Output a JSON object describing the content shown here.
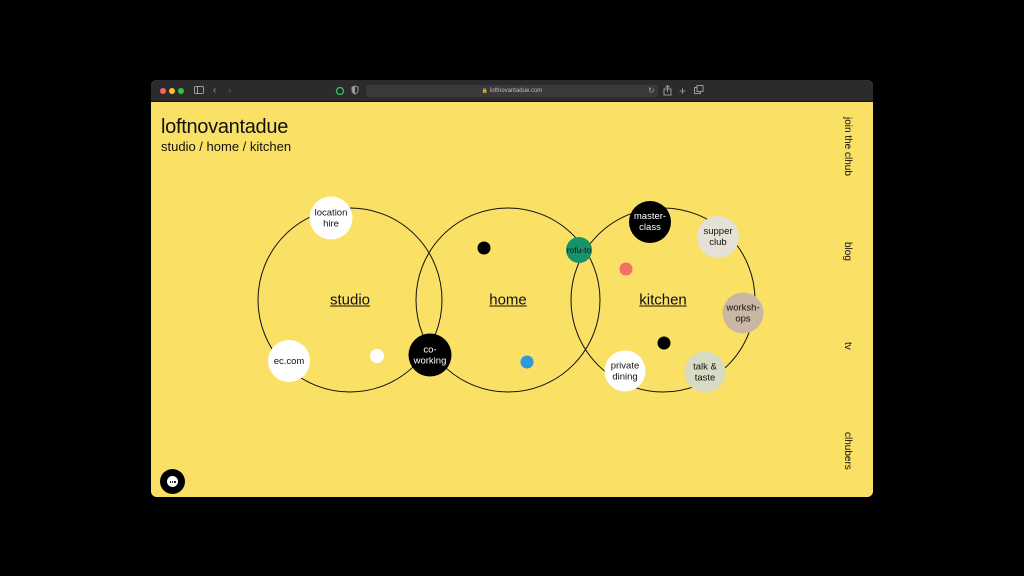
{
  "browser": {
    "url": "loftnovantadue.com",
    "traffic_lights": [
      "#ff5f57",
      "#febc2e",
      "#28c840"
    ],
    "icons": {
      "sidebar": "sidebar-icon",
      "back": "chevron-left-icon",
      "forward": "chevron-right-icon",
      "extension": "circle-icon",
      "shield": "shield-icon",
      "lock": "lock-icon",
      "reload": "reload-icon",
      "share": "share-icon",
      "new_tab": "plus-icon",
      "tabs": "tabs-icon"
    }
  },
  "site": {
    "title": "loftnovantadue",
    "subtitle": "studio / home / kitchen",
    "background": "#fbe066"
  },
  "side_nav": [
    "join the clhub",
    "blog",
    "tv",
    "clhubers"
  ],
  "venn": {
    "circles": [
      "studio",
      "home",
      "kitchen"
    ]
  },
  "bubbles": {
    "location_hire": "location hire",
    "ec_com": "ec.com",
    "co_working": "co-working",
    "rofu_to": "rofu-to",
    "master_class": "master-class",
    "supper_club": "supper club",
    "workshops": "worksh-ops",
    "private_dining": "private dining",
    "talk_taste": "talk & taste"
  },
  "colors": {
    "white": "#ffffff",
    "black": "#000000",
    "teal": "#17936c",
    "coral": "#f36d6a",
    "blue": "#2f98d8",
    "light_grey": "#e6e1d6",
    "taupe": "#c9b7a3",
    "sage": "#d8dbc4"
  },
  "chat_button": "chat-icon"
}
